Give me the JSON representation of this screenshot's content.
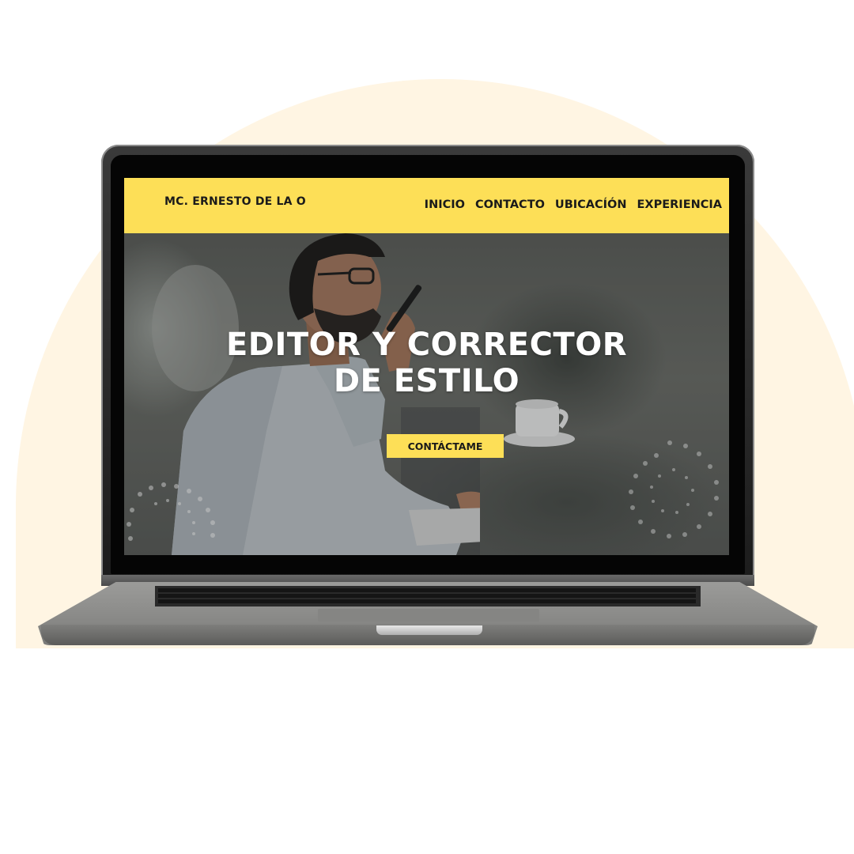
{
  "site": {
    "logo": "MC. ERNESTO DE LA O",
    "nav": [
      "INICIO",
      "CONTACTO",
      "UBICACÍÓN",
      "EXPERIENCIA"
    ]
  },
  "hero": {
    "title_line1": "EDITOR Y CORRECTOR",
    "title_line2": "DE ESTILO",
    "button_label": "CONTÁCTAME"
  },
  "colors": {
    "accent": "#fddf57",
    "background_blob": "#fff5e3",
    "laptop_body": "#8c8c8a"
  },
  "icons": [
    "dotted-spiral-decoration-icon"
  ]
}
